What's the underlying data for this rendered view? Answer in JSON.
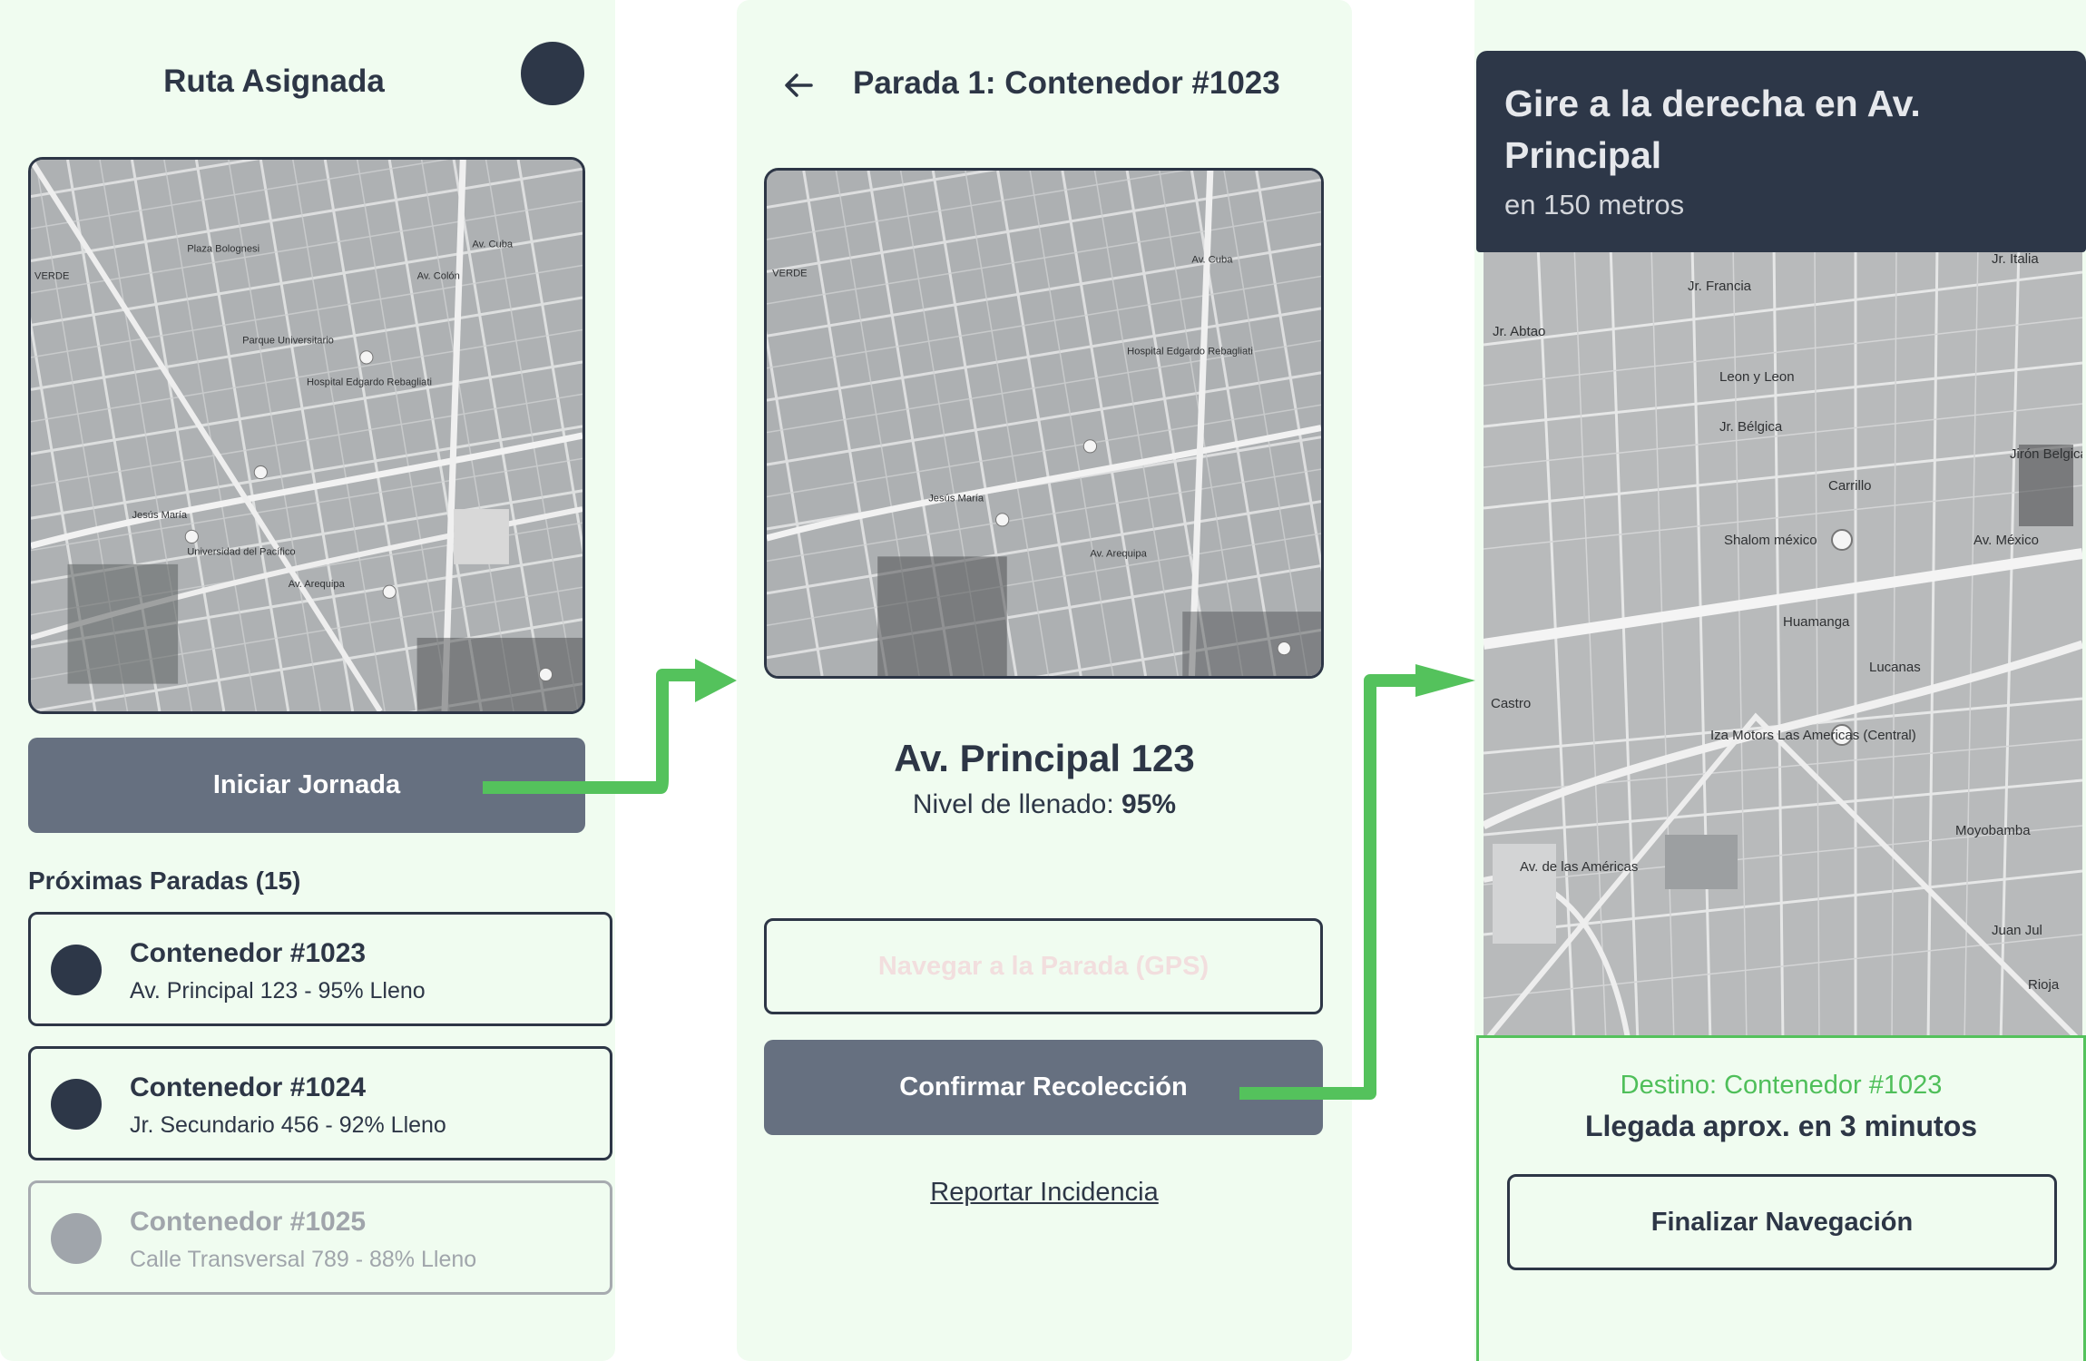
{
  "colors": {
    "accent": "#54c25c",
    "dark": "#2d3748",
    "button": "#667080",
    "panel": "#f0fcf0"
  },
  "screen1": {
    "title": "Ruta Asignada",
    "start_button": "Iniciar Jornada",
    "stops_heading": "Próximas Paradas (15)",
    "stops": [
      {
        "title": "Contenedor #1023",
        "subtitle": "Av. Principal 123 - 95% Lleno"
      },
      {
        "title": "Contenedor #1024",
        "subtitle": "Jr. Secundario 456 - 92% Lleno"
      },
      {
        "title": "Contenedor #1025",
        "subtitle": "Calle Transversal 789 - 88% Lleno"
      }
    ]
  },
  "screen2": {
    "back_icon": "arrow-left-icon",
    "title": "Parada 1: Contenedor #1023",
    "address": "Av. Principal 123",
    "fill_label": "Nivel de llenado:",
    "fill_value": "95%",
    "navigate_button": "Navegar a la Parada (GPS)",
    "confirm_button": "Confirmar Recolección",
    "report_link": "Reportar Incidencia"
  },
  "screen3": {
    "instruction": "Gire a la derecha en Av. Principal",
    "distance": "en 150 metros",
    "destination": "Destino: Contenedor #1023",
    "eta": "Llegada aprox. en 3 minutos",
    "finish_button": "Finalizar Navegación"
  },
  "map_labels": {
    "map1": [
      "Plaza Bolognesi",
      "Av. Colón",
      "Hospital Edgardo Rebagliati",
      "Parque Universitario",
      "Jesús María",
      "Universidad del Pacífico",
      "Av. Arequipa",
      "Av. Cuba",
      "VERDE"
    ],
    "map2": [
      "VERDE",
      "Av. Cuba",
      "Jesús María",
      "Hospital Edgardo Rebagliati",
      "Av. Arequipa"
    ],
    "map3": [
      "Jr. Italia",
      "Jr. Francia",
      "Leon y Leon",
      "Jr. Bélgica",
      "Jirón Belgica",
      "Shalom méxico",
      "Av. México",
      "Iza Motors Las Americas (Central)",
      "Av. de las Américas",
      "Moyobamba",
      "Huamanga",
      "Lucanas",
      "Castro",
      "Juan Jul",
      "Rioja",
      "Jr. Abtao",
      "Carrillo"
    ]
  }
}
